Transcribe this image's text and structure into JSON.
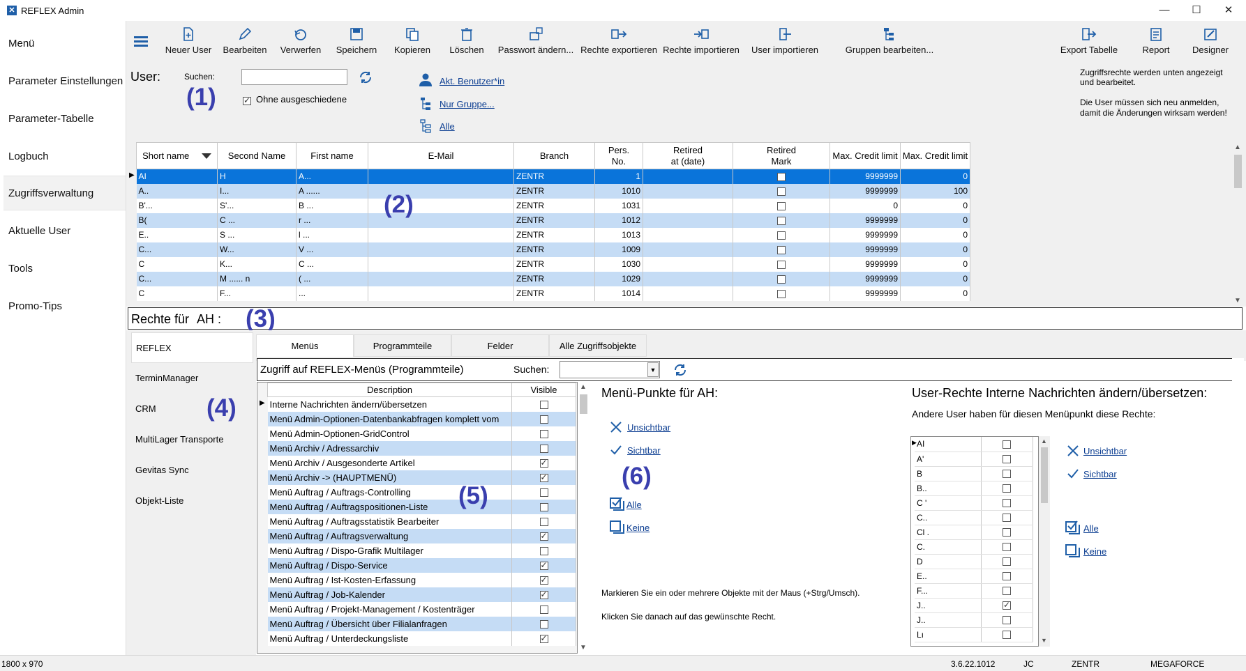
{
  "window": {
    "title": "REFLEX Admin",
    "min": "—",
    "max": "☐",
    "close": "✕"
  },
  "nav": [
    "Menü",
    "Parameter Einstellungen",
    "Parameter-Tabelle",
    "Logbuch",
    "Zugriffsverwaltung",
    "Aktuelle User",
    "Tools",
    "Promo-Tips"
  ],
  "toolbar": {
    "new_user": "Neuer User",
    "edit": "Bearbeiten",
    "discard": "Verwerfen",
    "save": "Speichern",
    "copy": "Kopieren",
    "delete": "Löschen",
    "password": "Passwort ändern...",
    "export_rights": "Rechte exportieren",
    "import_rights": "Rechte importieren",
    "import_user": "User importieren",
    "edit_groups": "Gruppen bearbeiten...",
    "export_table": "Export Tabelle",
    "report": "Report",
    "designer": "Designer"
  },
  "user": {
    "label": "User:",
    "search_label": "Suchen:",
    "search_value": "",
    "without_retired": "Ohne ausgeschiedene",
    "link_current": "Akt. Benutzer*in",
    "link_group": "Nur Gruppe...",
    "link_all": "Alle",
    "info1": "Zugriffsrechte werden unten angezeigt",
    "info2": "und bearbeitet.",
    "info3": "Die User müssen sich neu  anmelden,",
    "info4": "damit die Änderungen wirksam werden!"
  },
  "annotations": {
    "a1": "(1)",
    "a2": "(2)",
    "a3": "(3)",
    "a4": "(4)",
    "a5": "(5)",
    "a6": "(6)"
  },
  "users_table": {
    "columns": [
      "Short name",
      "Second Name",
      "First name",
      "E-Mail",
      "Branch",
      "Pers.\nNo.",
      "Retired\nat (date)",
      "Retired\nMark",
      "Max. Credit limit",
      "Max. Credit limit"
    ],
    "rows": [
      {
        "short": "AI",
        "second": "H",
        "first": "A...",
        "email": "",
        "branch": "ZENTR",
        "no": "1",
        "retired": "",
        "mark": false,
        "c1": "9999999",
        "c2": "0"
      },
      {
        "short": "A..",
        "second": "I...",
        "first": "A ......",
        "email": "",
        "branch": "ZENTR",
        "no": "1010",
        "retired": "",
        "mark": false,
        "c1": "9999999",
        "c2": "100"
      },
      {
        "short": "B'...",
        "second": "S'...",
        "first": "B ...",
        "email": "",
        "branch": "ZENTR",
        "no": "1031",
        "retired": "",
        "mark": false,
        "c1": "0",
        "c2": "0"
      },
      {
        "short": "B(",
        "second": "C ...",
        "first": "r ...",
        "email": "",
        "branch": "ZENTR",
        "no": "1012",
        "retired": "",
        "mark": false,
        "c1": "9999999",
        "c2": "0"
      },
      {
        "short": "E..",
        "second": "S ...",
        "first": "l ...",
        "email": "",
        "branch": "ZENTR",
        "no": "1013",
        "retired": "",
        "mark": false,
        "c1": "9999999",
        "c2": "0"
      },
      {
        "short": "C...",
        "second": "W...",
        "first": "V ...",
        "email": "",
        "branch": "ZENTR",
        "no": "1009",
        "retired": "",
        "mark": false,
        "c1": "9999999",
        "c2": "0"
      },
      {
        "short": "C",
        "second": "K...",
        "first": "C ...",
        "email": "",
        "branch": "ZENTR",
        "no": "1030",
        "retired": "",
        "mark": false,
        "c1": "9999999",
        "c2": "0"
      },
      {
        "short": "C...",
        "second": "M ...... n",
        "first": "( ...",
        "email": "",
        "branch": "ZENTR",
        "no": "1029",
        "retired": "",
        "mark": false,
        "c1": "9999999",
        "c2": "0"
      },
      {
        "short": "C",
        "second": "F...",
        "first": "...",
        "email": "",
        "branch": "ZENTR",
        "no": "1014",
        "retired": "",
        "mark": false,
        "c1": "9999999",
        "c2": "0"
      }
    ]
  },
  "rechte": {
    "label": "Rechte für",
    "user": "AH :"
  },
  "side_tabs": [
    "REFLEX",
    "TerminManager",
    "CRM",
    "MultiLager Transporte",
    "Gevitas Sync",
    "Objekt-Liste"
  ],
  "panel_tabs": [
    "Menüs",
    "Programmteile",
    "Felder",
    "Alle Zugriffsobjekte"
  ],
  "access": {
    "title": "Zugriff auf REFLEX-Menüs (Programmteile)",
    "search_label": "Suchen:"
  },
  "menu_table": {
    "col_desc": "Description",
    "col_visible": "Visible",
    "rows": [
      {
        "d": "Interne Nachrichten ändern/übersetzen",
        "v": false
      },
      {
        "d": "Menü Admin-Optionen-Datenbankabfragen komplett vom",
        "v": false
      },
      {
        "d": "Menü Admin-Optionen-GridControl",
        "v": false
      },
      {
        "d": "Menü Archiv / Adressarchiv",
        "v": false
      },
      {
        "d": "Menü Archiv / Ausgesonderte Artikel",
        "v": true
      },
      {
        "d": "Menü Archiv -> (HAUPTMENÜ)",
        "v": true
      },
      {
        "d": "Menü Auftrag / Auftrags-Controlling",
        "v": false
      },
      {
        "d": "Menü Auftrag / Auftragspositionen-Liste",
        "v": false
      },
      {
        "d": "Menü Auftrag / Auftragsstatistik Bearbeiter",
        "v": false
      },
      {
        "d": "Menü Auftrag / Auftragsverwaltung",
        "v": true
      },
      {
        "d": "Menü Auftrag / Dispo-Grafik Multilager",
        "v": false
      },
      {
        "d": "Menü Auftrag / Dispo-Service",
        "v": true
      },
      {
        "d": "Menü Auftrag / Ist-Kosten-Erfassung",
        "v": true
      },
      {
        "d": "Menü Auftrag / Job-Kalender",
        "v": true
      },
      {
        "d": "Menü Auftrag / Projekt-Management / Kostenträger",
        "v": false
      },
      {
        "d": "Menü Auftrag / Übersicht über Filialanfragen",
        "v": false
      },
      {
        "d": "Menü Auftrag / Unterdeckungsliste",
        "v": true
      }
    ]
  },
  "menu_points": {
    "title": "Menü-Punkte für AH:",
    "invisible": "Unsichtbar",
    "visible": "Sichtbar",
    "all": "Alle",
    "none": "Keine",
    "hint1": "Markieren Sie ein oder mehrere Objekte mit der Maus (+Strg/Umsch).",
    "hint2": "Klicken Sie danach auf das gewünschte Recht."
  },
  "user_rights": {
    "title": "User-Rechte Interne Nachrichten ändern/übersetzen:",
    "subtitle": "Andere User haben für diesen Menüpunkt diese Rechte:",
    "invisible": "Unsichtbar",
    "visible": "Sichtbar",
    "all": "Alle",
    "none": "Keine",
    "rows": [
      {
        "u": "AI",
        "v": false
      },
      {
        "u": "A'",
        "v": false
      },
      {
        "u": "B",
        "v": false
      },
      {
        "u": "B..",
        "v": false
      },
      {
        "u": "C '",
        "v": false
      },
      {
        "u": "C..",
        "v": false
      },
      {
        "u": "Cl .",
        "v": false
      },
      {
        "u": "C.",
        "v": false
      },
      {
        "u": "D",
        "v": false
      },
      {
        "u": "E..",
        "v": false
      },
      {
        "u": "F...",
        "v": false
      },
      {
        "u": "J..",
        "v": true
      },
      {
        "u": "J..",
        "v": false
      },
      {
        "u": "Lı",
        "v": false
      }
    ]
  },
  "status": {
    "size": "1800 x 970",
    "version": "3.6.22.1012",
    "user": "JC",
    "branch": "ZENTR",
    "db": "MEGAFORCE"
  },
  "colors": {
    "accent": "#1f5fa8",
    "selection": "#0a74da",
    "row_alt": "#c5dcf5",
    "annotation": "#3a3fae"
  }
}
